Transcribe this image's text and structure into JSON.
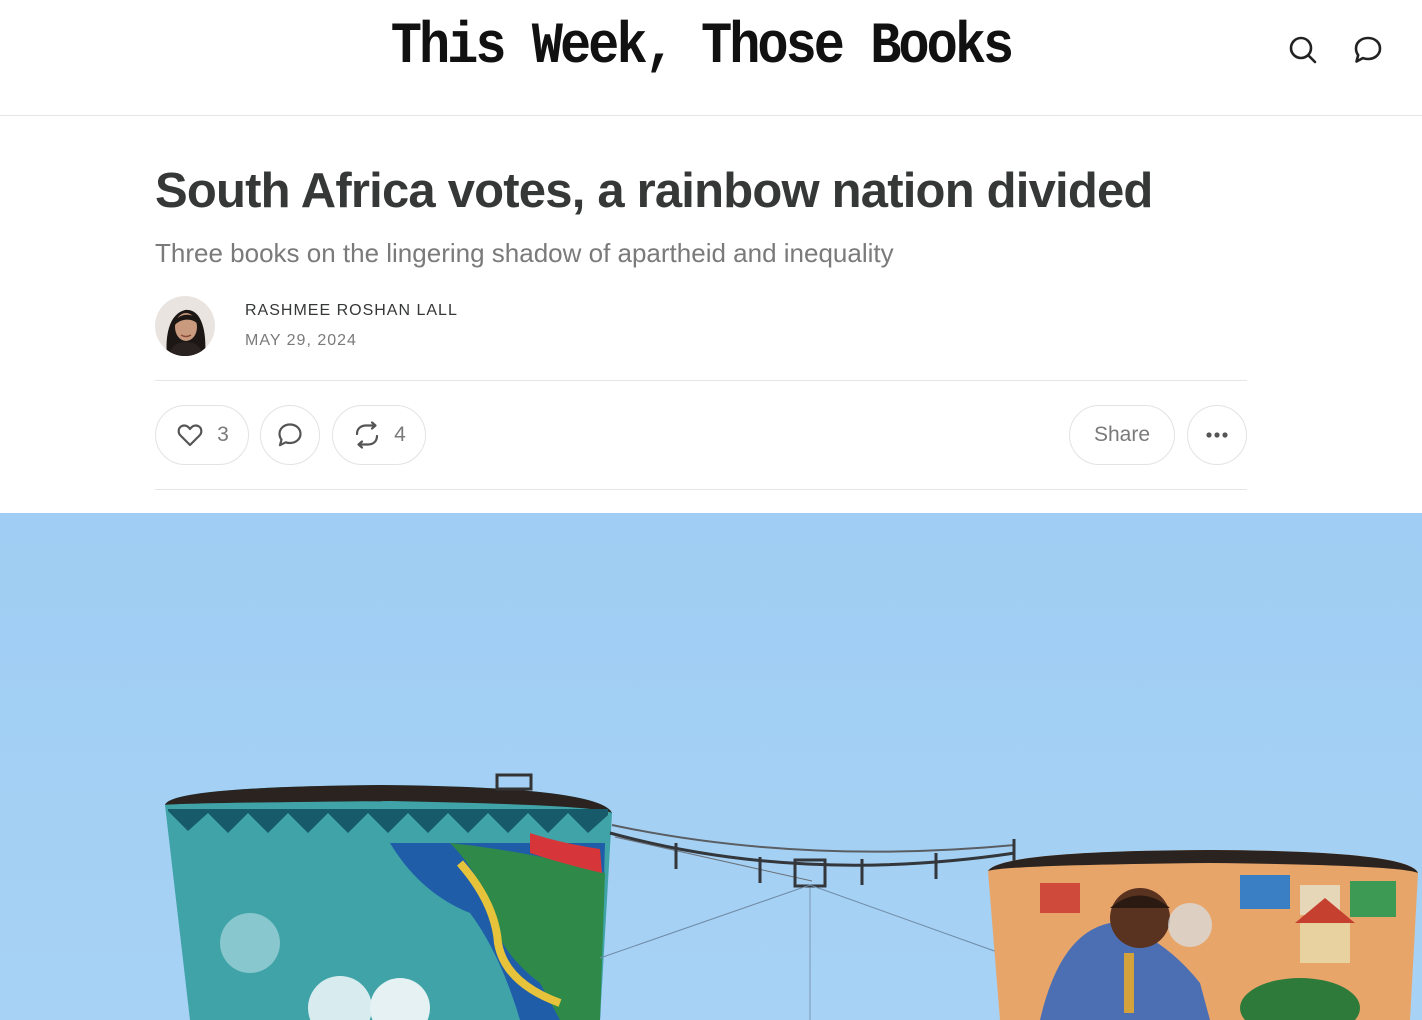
{
  "site": {
    "title": "This Week, Those Books"
  },
  "post": {
    "title": "South Africa votes, a rainbow nation divided",
    "subtitle": "Three books on the lingering shadow of apartheid and inequality",
    "author": "RASHMEE ROSHAN LALL",
    "date": "MAY 29, 2024"
  },
  "actions": {
    "like_count": "3",
    "restack_count": "4",
    "share_label": "Share"
  },
  "icons": {
    "header": [
      "search-icon",
      "chat-bubble-icon"
    ],
    "actions": [
      "heart-icon",
      "chat-bubble-icon",
      "restack-icon",
      "more-dots-icon"
    ]
  },
  "colors": {
    "text": "#363737",
    "muted": "#7a7a7a",
    "border": "#e6e6e6",
    "sky": "#9ccbf2"
  }
}
